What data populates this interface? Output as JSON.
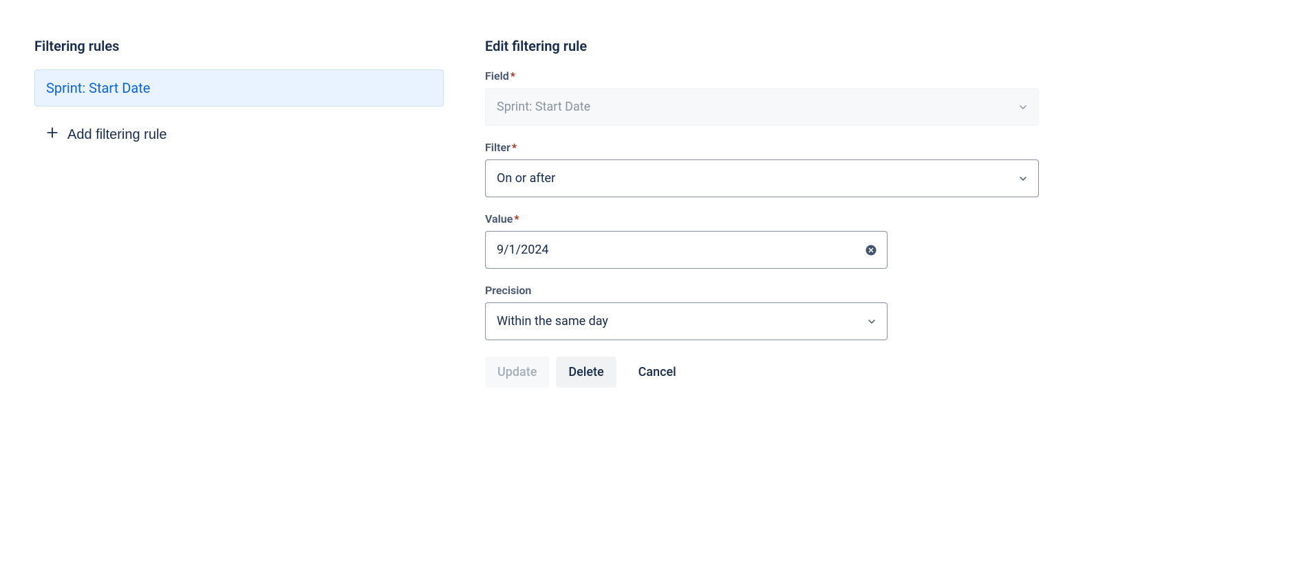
{
  "left": {
    "title": "Filtering rules",
    "rules": [
      {
        "label": "Sprint: Start Date"
      }
    ],
    "add_label": "Add filtering rule"
  },
  "form": {
    "title": "Edit filtering rule",
    "field": {
      "label": "Field",
      "value": "Sprint: Start Date"
    },
    "filter": {
      "label": "Filter",
      "value": "On or after"
    },
    "value": {
      "label": "Value",
      "value": "9/1/2024"
    },
    "precision": {
      "label": "Precision",
      "value": "Within the same day"
    },
    "actions": {
      "update": "Update",
      "delete": "Delete",
      "cancel": "Cancel"
    }
  }
}
